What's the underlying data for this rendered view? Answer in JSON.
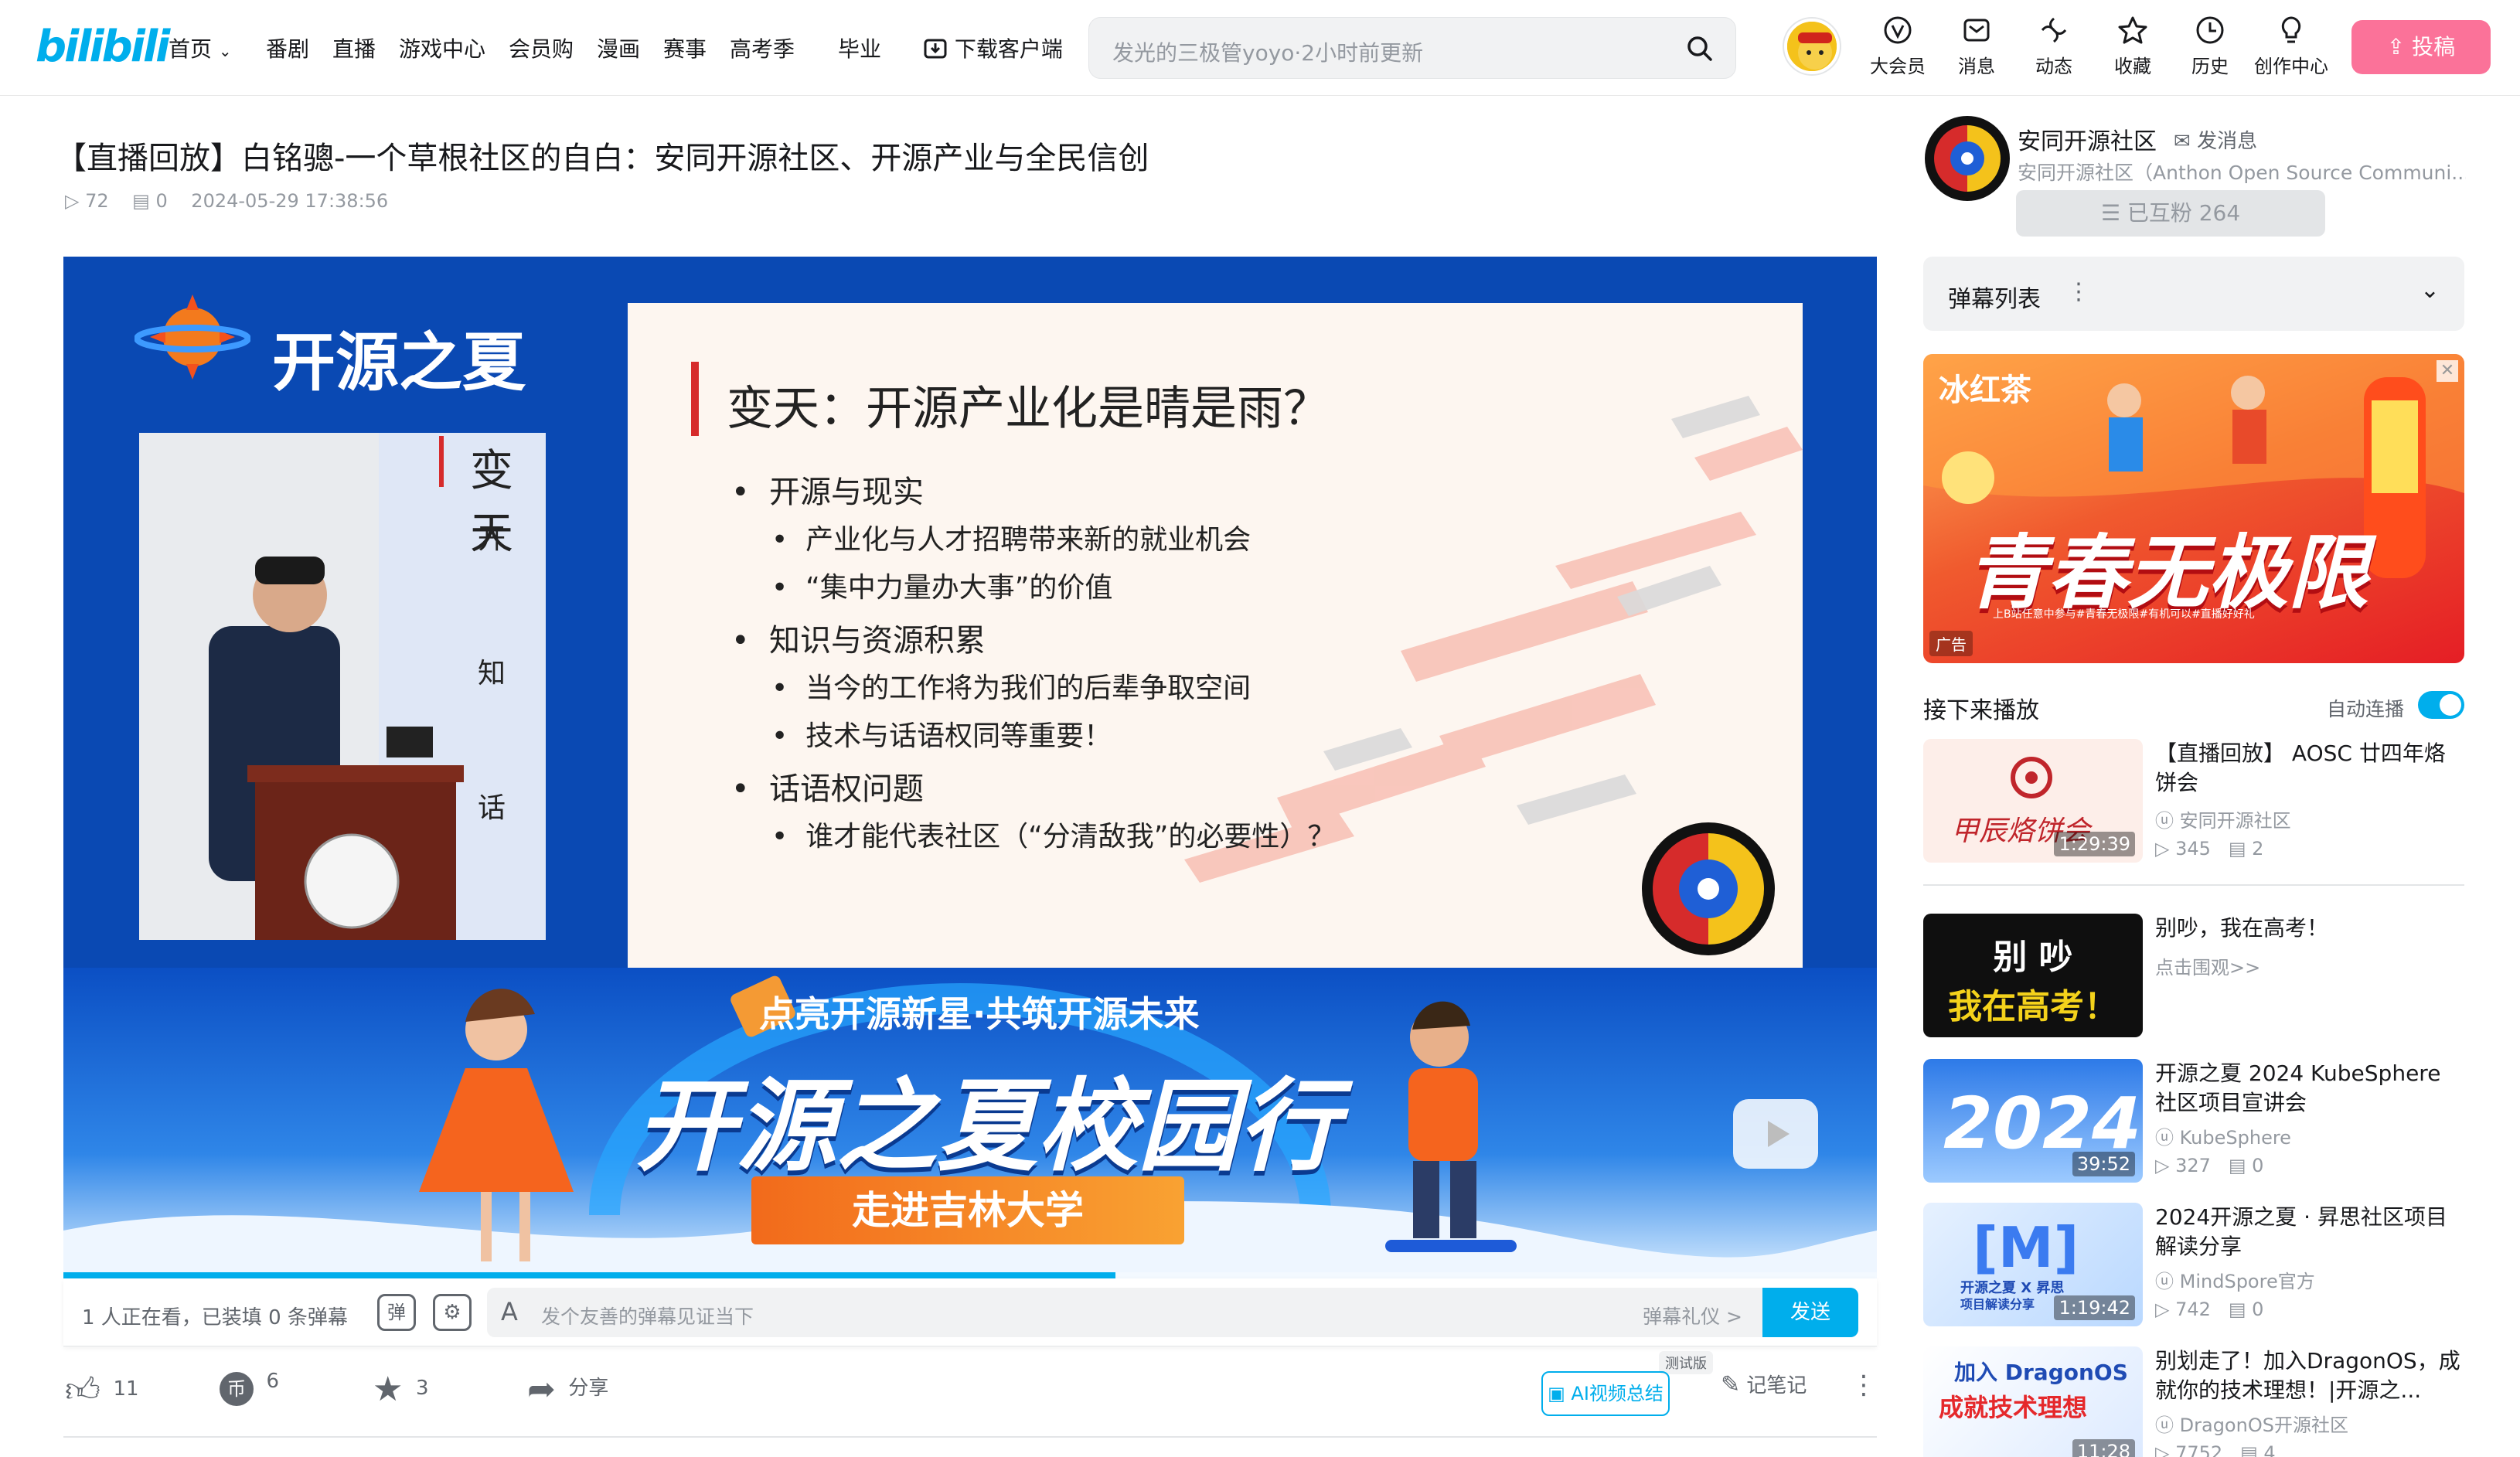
{
  "header": {
    "logo": "bilibili",
    "nav": [
      "首页",
      "番剧",
      "直播",
      "游戏中心",
      "会员购",
      "漫画",
      "赛事",
      "高考季",
      "毕业"
    ],
    "download": "下载客户端",
    "search_placeholder": "发光的三极管yoyo·2小时前更新",
    "icons": [
      {
        "name": "big-member",
        "label": "大会员"
      },
      {
        "name": "message",
        "label": "消息"
      },
      {
        "name": "dynamic",
        "label": "动态"
      },
      {
        "name": "favorite",
        "label": "收藏"
      },
      {
        "name": "history",
        "label": "历史"
      },
      {
        "name": "creator",
        "label": "创作中心"
      }
    ],
    "upload": "投稿",
    "accent": "#fb7299",
    "brand": "#00aeec"
  },
  "video": {
    "title": "【直播回放】白铭骢-一个草根社区的自白：安同开源社区、开源产业与全民信创",
    "plays": "72",
    "danmaku": "0",
    "date": "2024-05-29 17:38:56"
  },
  "slide": {
    "brand": "开源之夏",
    "cut_heading": "变天",
    "cut_items": [
      "开",
      "知",
      "话"
    ],
    "heading": "变天：开源产业化是晴是雨？",
    "sections": [
      {
        "t": "开源与现实",
        "items": [
          "产业化与人才招聘带来新的就业机会",
          "“集中力量办大事”的价值"
        ]
      },
      {
        "t": "知识与资源积累",
        "items": [
          "当今的工作将为我们的后辈争取空间",
          "技术与话语权同等重要！"
        ]
      },
      {
        "t": "话语权问题",
        "items": [
          "谁才能代表社区（“分清敌我”的必要性）？"
        ]
      }
    ],
    "banner_sub": "点亮开源新星·共筑开源未来",
    "banner_main": "开源之夏校园行",
    "banner_ribbon": "走进吉林大学"
  },
  "player": {
    "progress": 0.58,
    "watching": "1 人正在看，已装填 0 条弹幕",
    "dm_placeholder": "发个友善的弹幕见证当下",
    "dm_etiquette": "弹幕礼仪 >",
    "send": "发送"
  },
  "actions": {
    "like": "11",
    "coin": "6",
    "fav": "3",
    "share": "分享",
    "ai_badge": "测试版",
    "ai": "AI视频总结",
    "notes": "记笔记"
  },
  "uploader": {
    "name": "安同开源社区",
    "msg": "发消息",
    "desc": "安同开源社区（Anthon Open Source Communi...",
    "follow": "已互粉 264"
  },
  "danmaku_list": "弹幕列表",
  "ad": {
    "line1": "青春无极限",
    "tag": "广告",
    "small": "上B站任意中参与#青春无极限#有机可以#直播好好礼"
  },
  "next": {
    "label": "接下来播放",
    "autoplay": "自动连播",
    "autoplay_on": true
  },
  "recs": [
    {
      "title": "【直播回放】 AOSC 廿四年烙饼会",
      "up": "安同开源社区",
      "views": "345",
      "dm": "2",
      "dur": "1:29:39",
      "thumb_text": "甲辰烙饼会"
    },
    {
      "title": "别吵，我在高考！",
      "sub": "点击围观>>",
      "thumb_l1": "别 吵",
      "thumb_l2": "我在高考！"
    },
    {
      "title": "开源之夏 2024 KubeSphere 社区项目宣讲会",
      "up": "KubeSphere",
      "views": "327",
      "dm": "0",
      "dur": "39:52",
      "thumb_text": "2024"
    },
    {
      "title": "2024开源之夏 · 昇思社区项目解读分享",
      "up": "MindSpore官方",
      "views": "742",
      "dm": "0",
      "dur": "1:19:42",
      "thumb_text": "[M]",
      "thumb_sub": "开源之夏 X 昇思",
      "thumb_sub2": "项目解读分享"
    },
    {
      "title": "别划走了！加入DragonOS，成就你的技术理想！|开源之...",
      "up": "DragonOS开源社区",
      "views": "7752",
      "dm": "4",
      "dur": "11:28",
      "thumb_text": "加入 DragonOS",
      "thumb_sub": "成就技术理想"
    }
  ]
}
